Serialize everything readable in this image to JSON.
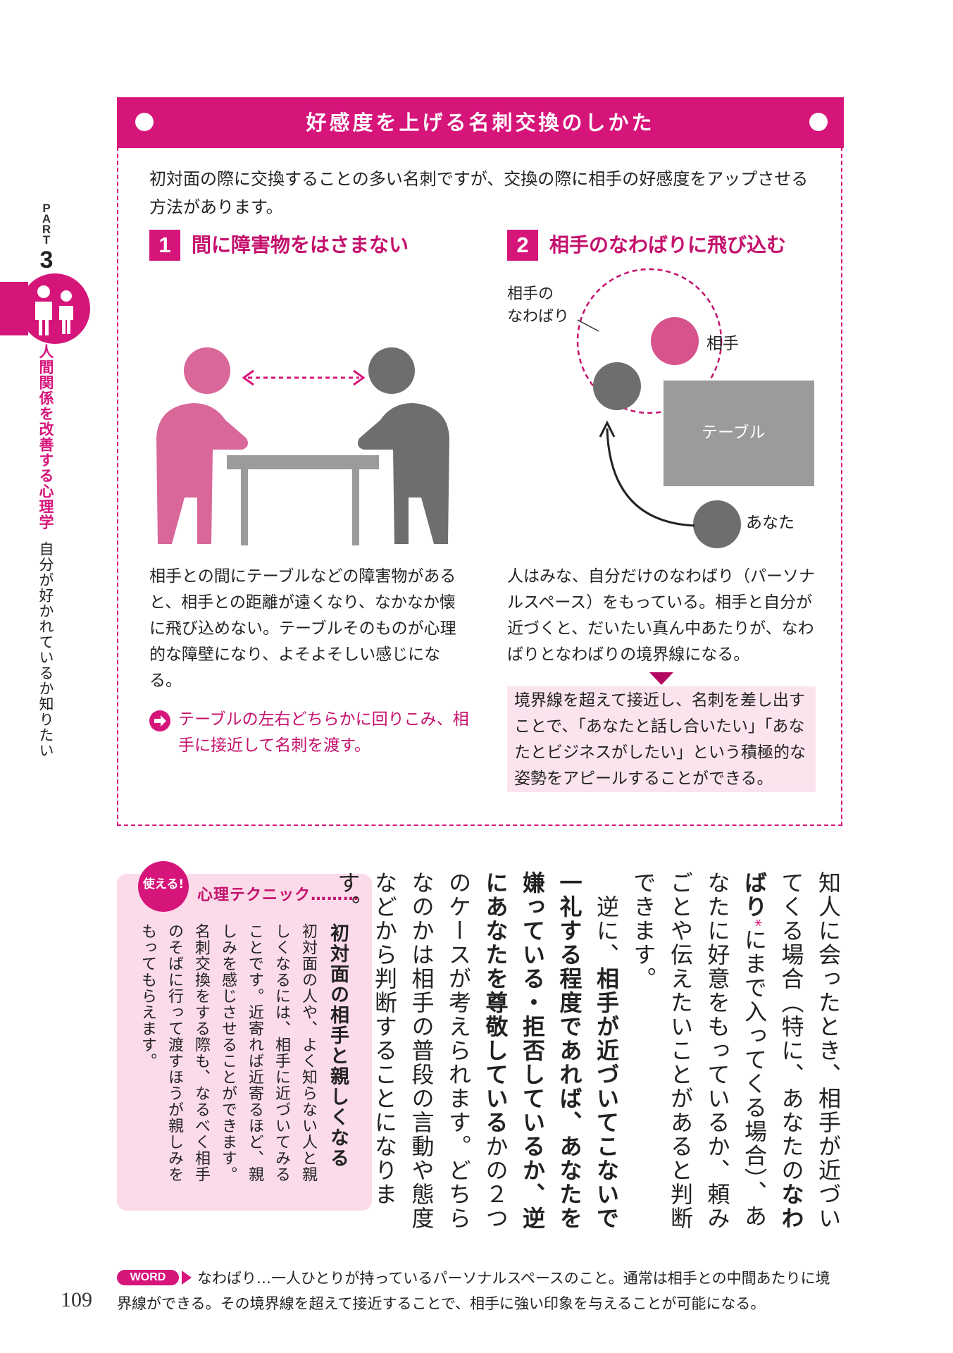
{
  "side": {
    "part_label": "PART",
    "part_number": "3",
    "chapter_title": "人間関係を改善する心理学",
    "chapter_subtitle": "自分が好かれているか知りたい"
  },
  "box": {
    "title": "好感度を上げる名刺交換のしかた",
    "intro": "初対面の際に交換することの多い名刺ですが、交換の際に相手の好感度をアップさせる方法があります。"
  },
  "section1": {
    "number": "1",
    "title": "間に障害物をはさまない",
    "body": "相手との間にテーブルなどの障害物があると、相手との距離が遠くなり、なかなか懐に飛び込めない。テーブルそのものが心理的な障壁になり、よそよそしい感じになる。",
    "tip": "テーブルの左右どちらかに回りこみ、相手に接近して名刺を渡す。"
  },
  "section2": {
    "number": "2",
    "title": "相手のなわばりに飛び込む",
    "label_territory": "相手の\nなわばり",
    "label_partner": "相手",
    "label_table": "テーブル",
    "label_you": "あなた",
    "body": "人はみな、自分だけのなわばり（パーソナルスペース）をもっている。相手と自分が近づくと、だいたい真ん中あたりが、なわばりとなわばりの境界線になる。",
    "result": "境界線を超えて接近し、名刺を差し出すことで、「あなたと話し合いたい」「あなたとビジネスがしたい」という積極的な姿勢をアピールすることができる。"
  },
  "technique": {
    "badge": "使える!",
    "label": "心理テクニック………",
    "heading": "初対面の相手と親しくなる",
    "body": "初対面の人や、よく知らない人と親しくなるには、相手に近づいてみることです。近寄れば近寄るほど、親しみを感じさせることができます。名刺交換をする際も、なるべく相手のそばに行って渡すほうが親しみをもってもらえます。"
  },
  "main_text": {
    "p1": "知人に会ったとき、相手が近づいてくる場合（特に、あなたの",
    "p1_bold": "なわばり",
    "p1_rest": "にまで入ってくる場合）、あなたに好意をもっているか、頼みごとや伝えたいことがあると判断できます。",
    "p2_a": "逆に、",
    "p2_bold1": "相手が近づいてこないで一礼する程度であれば、あなたを嫌っている・拒否しているか、逆にあなたを尊敬している",
    "p2_b": "かの２つのケースが考えられます。どちらなのかは相手の普段の言動や態度などから判断することになります。"
  },
  "footer": {
    "word_badge": "WORD",
    "line1": "なわばり…一人ひとりが持っているパーソナルスペースのこと。通常は相手との中間あたりに境",
    "line2": "界線ができる。その境界線を超えて接近することで、相手に強い印象を与えることが可能になる。",
    "page_number": "109"
  },
  "colors": {
    "accent": "#d6157b",
    "figure_pink": "#d9679a",
    "figure_gray": "#6e6e6e",
    "table_gray": "#9b9b9b",
    "result_bg": "#fce4ef"
  }
}
